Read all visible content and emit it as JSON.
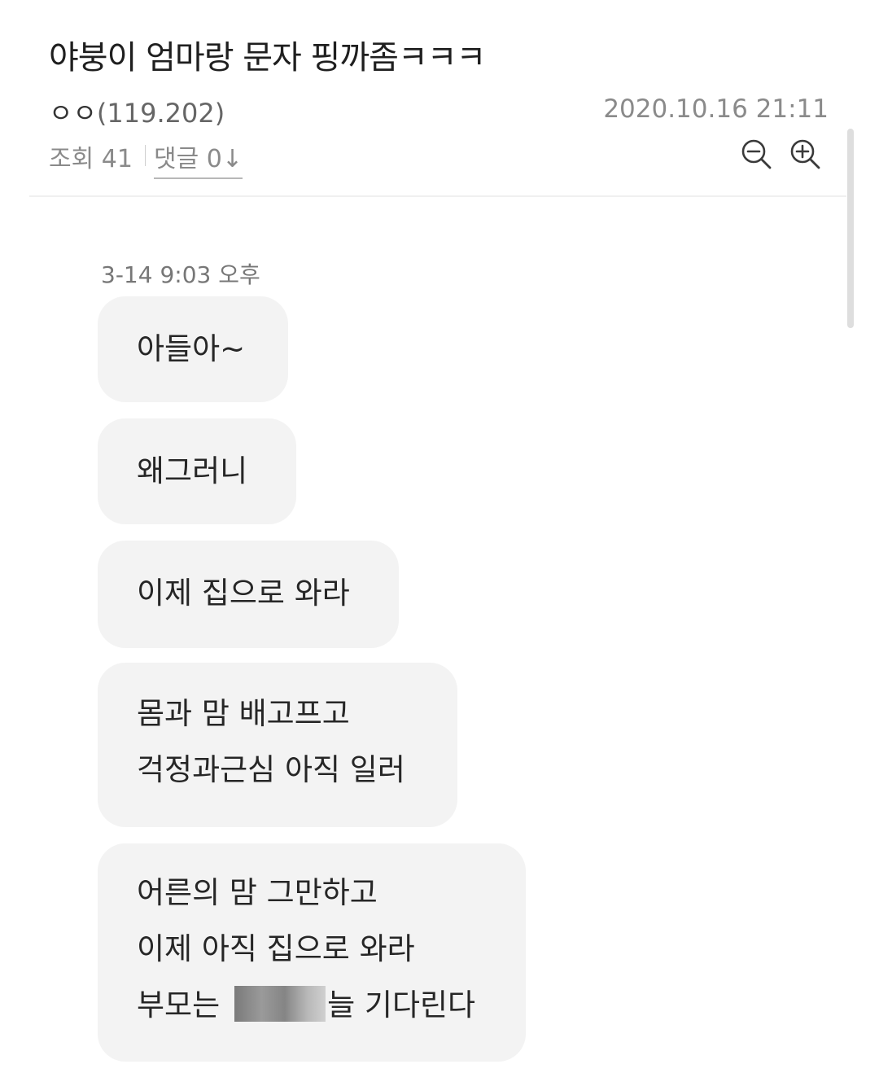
{
  "post": {
    "title": "야붕이 엄마랑 문자 핑까좀ㅋㅋㅋ",
    "author_name": "ㅇㅇ",
    "author_ip": "(119.202)",
    "date": "2020.10.16 21:11",
    "views": "조회 41",
    "comments": "댓글 0↓",
    "zoom_out_icon": "zoom-out-icon",
    "zoom_in_icon": "zoom-in-icon"
  },
  "conversation": {
    "timestamp": "3-14 9:03 오후",
    "messages": [
      {
        "lines": [
          "아들아~"
        ]
      },
      {
        "lines": [
          "왜그러니"
        ]
      },
      {
        "lines": [
          "이제 집으로 와라"
        ]
      },
      {
        "lines": [
          "몸과 맘 배고프고",
          "걱정과근심 아직 일러"
        ]
      },
      {
        "lines": [
          "어른의 맘  그만하고",
          "이제 아직 집으로 와라",
          "부모는",
          "늘 기다린다"
        ]
      }
    ]
  },
  "colors": {
    "bubble_background": "#f3f3f3",
    "muted_text": "#8a8a8a",
    "text": "#222222"
  }
}
